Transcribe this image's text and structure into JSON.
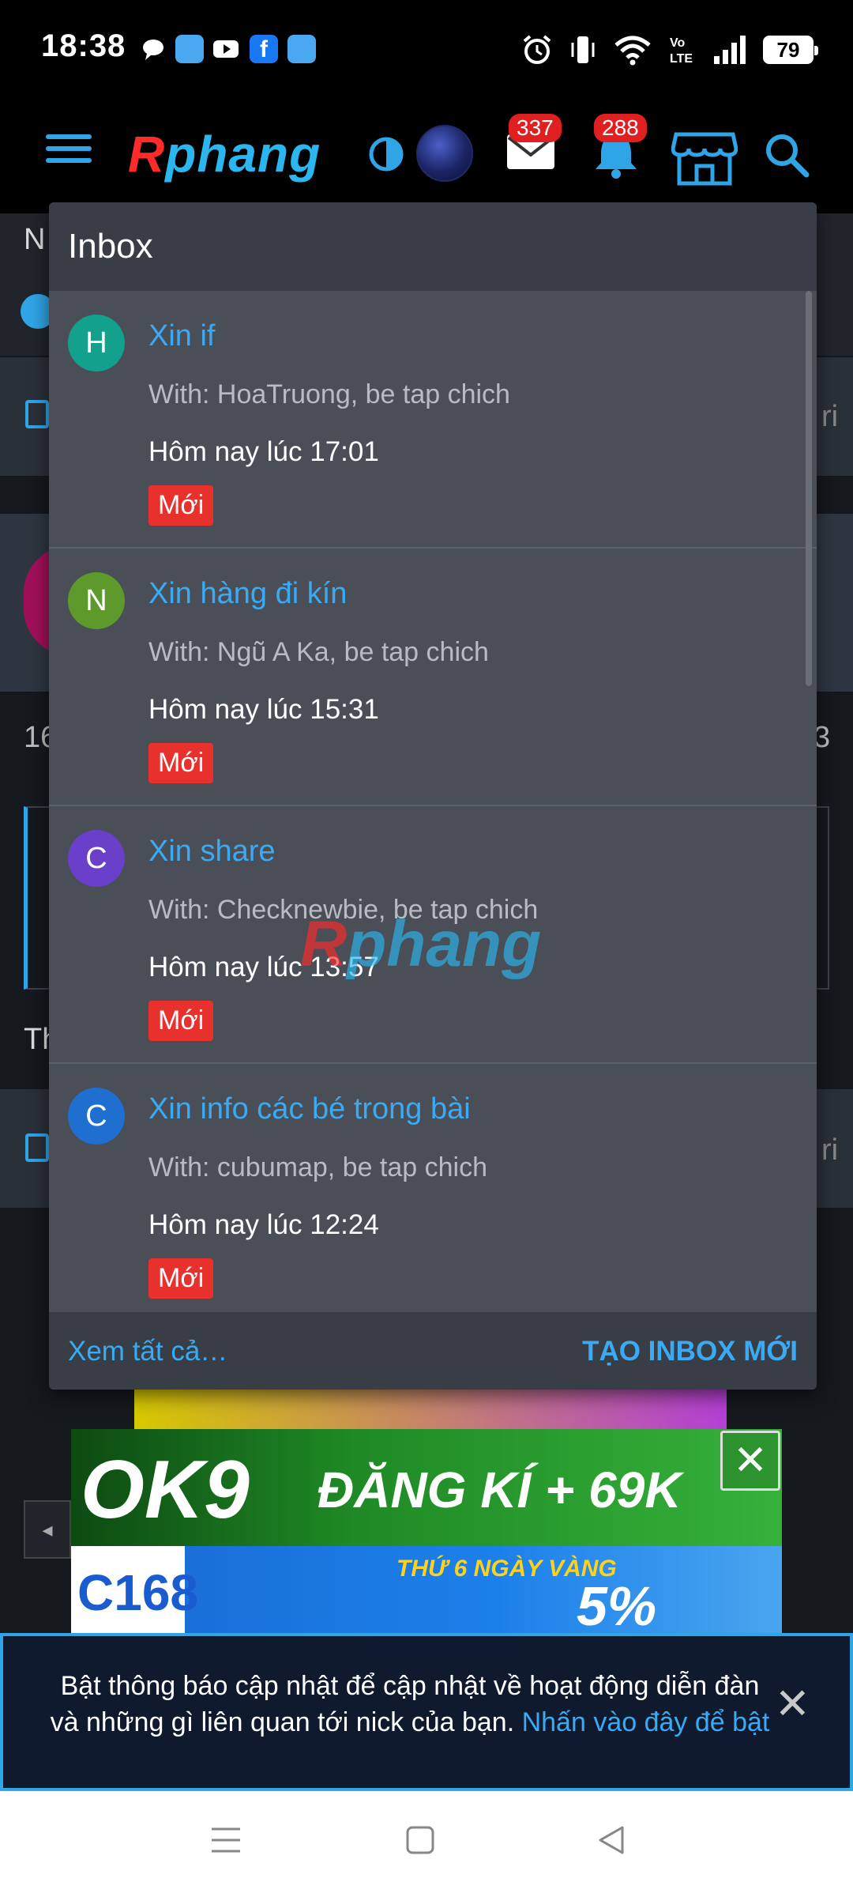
{
  "status_bar": {
    "time": "18:38",
    "battery": "79",
    "icons": [
      "message-bubble-icon",
      "weather-app-icon",
      "youtube-icon",
      "facebook-icon",
      "weather-app-icon",
      "alarm-icon",
      "vibrate-icon",
      "wifi-icon",
      "volte-icon",
      "signal-icon",
      "battery-icon"
    ],
    "volte_label": "Vo\nLTE"
  },
  "header": {
    "logo_first": "R",
    "logo_rest": "phang",
    "mail_badge": "337",
    "bell_badge": "288",
    "accent_color": "#2fa4e7"
  },
  "background_page": {
    "title_initial": "N",
    "number_left": "16",
    "number_right": "3",
    "section_initial": "Th",
    "row_suffix_1": "ri",
    "row_suffix_2": "ri"
  },
  "inbox": {
    "title": "Inbox",
    "items": [
      {
        "avatar": "H",
        "avatar_color": "#13a08c",
        "title": "Xin if",
        "with": "With: HoaTruong, be tap chich",
        "time": "Hôm nay lúc 17:01",
        "badge": "Mới"
      },
      {
        "avatar": "N",
        "avatar_color": "#5d9a2b",
        "title": "Xin hàng đi kín",
        "with": "With: Ngũ A Ka, be tap chich",
        "time": "Hôm nay lúc 15:31",
        "badge": "Mới"
      },
      {
        "avatar": "C",
        "avatar_color": "#6a3fc9",
        "title": "Xin share",
        "with": "With: Checknewbie, be tap chich",
        "time": "Hôm nay lúc 13:57",
        "badge": "Mới"
      },
      {
        "avatar": "C",
        "avatar_color": "#1f6fd1",
        "title": "Xin info các bé trong bài",
        "with": "With: cubumap, be tap chich",
        "time": "Hôm nay lúc 12:24",
        "badge": "Mới"
      }
    ],
    "footer": {
      "view_all": "Xem tất cả…",
      "new_inbox": "TẠO INBOX MỚI"
    }
  },
  "watermark": {
    "first": "R",
    "rest": "phang"
  },
  "ads": {
    "ok9_logo": "OK9",
    "ok9_text": "ĐĂNG KÍ + 69K",
    "close": "✕",
    "c168_logo": "C168",
    "c168_promo": "THỨ 6 NGÀY VÀNG",
    "c168_pct": "5%"
  },
  "notification": {
    "text": "Bật thông báo cập nhật để cập nhật về hoạt động diễn đàn và những gì liên quan tới nick của bạn.",
    "link": "Nhấn vào đây để bật",
    "close": "✕"
  }
}
